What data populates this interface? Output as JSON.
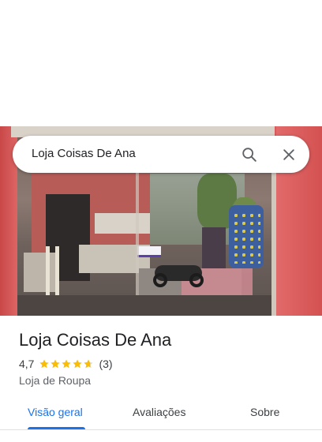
{
  "search": {
    "query": "Loja Coisas De Ana",
    "search_icon": "search-icon",
    "close_icon": "close-icon"
  },
  "place": {
    "name": "Loja Coisas De Ana",
    "rating": "4,7",
    "rating_stars": 4.7,
    "review_count": "(3)",
    "category": "Loja de Roupa"
  },
  "tabs": [
    {
      "label": "Visão geral",
      "selected": true
    },
    {
      "label": "Avaliações",
      "selected": false
    },
    {
      "label": "Sobre",
      "selected": false
    }
  ],
  "colors": {
    "accent": "#1a73e8",
    "star": "#fbbc04",
    "title": "#202124",
    "secondary": "#5f6368"
  }
}
